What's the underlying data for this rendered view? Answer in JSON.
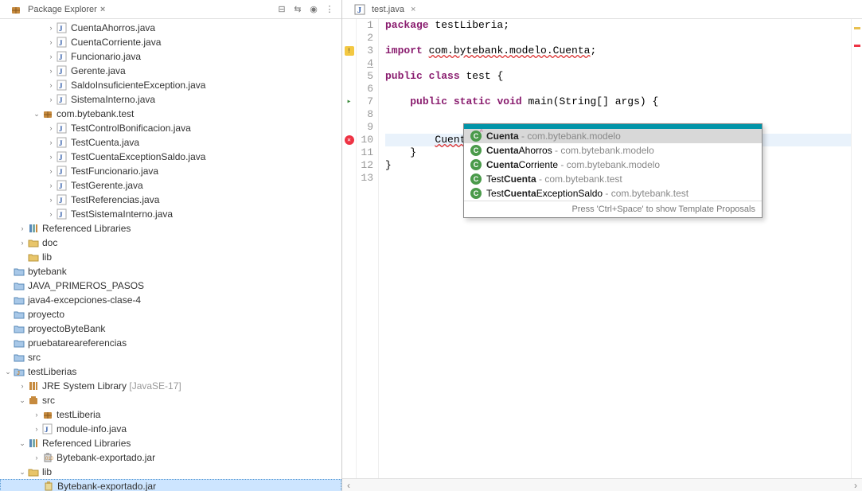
{
  "explorer": {
    "title": "Package Explorer",
    "tree": [
      {
        "indent": 3,
        "twisty": ">",
        "icon": "java",
        "label": "CuentaAhorros.java"
      },
      {
        "indent": 3,
        "twisty": ">",
        "icon": "java",
        "label": "CuentaCorriente.java"
      },
      {
        "indent": 3,
        "twisty": ">",
        "icon": "java",
        "label": "Funcionario.java"
      },
      {
        "indent": 3,
        "twisty": ">",
        "icon": "java",
        "label": "Gerente.java"
      },
      {
        "indent": 3,
        "twisty": ">",
        "icon": "java",
        "label": "SaldoInsuficienteException.java"
      },
      {
        "indent": 3,
        "twisty": ">",
        "icon": "java",
        "label": "SistemaInterno.java"
      },
      {
        "indent": 2,
        "twisty": "v",
        "icon": "pkg",
        "label": "com.bytebank.test"
      },
      {
        "indent": 3,
        "twisty": ">",
        "icon": "java",
        "label": "TestControlBonificacion.java"
      },
      {
        "indent": 3,
        "twisty": ">",
        "icon": "java",
        "label": "TestCuenta.java"
      },
      {
        "indent": 3,
        "twisty": ">",
        "icon": "java",
        "label": "TestCuentaExceptionSaldo.java"
      },
      {
        "indent": 3,
        "twisty": ">",
        "icon": "java",
        "label": "TestFuncionario.java"
      },
      {
        "indent": 3,
        "twisty": ">",
        "icon": "java",
        "label": "TestGerente.java"
      },
      {
        "indent": 3,
        "twisty": ">",
        "icon": "java",
        "label": "TestReferencias.java"
      },
      {
        "indent": 3,
        "twisty": ">",
        "icon": "java",
        "label": "TestSistemaInterno.java"
      },
      {
        "indent": 1,
        "twisty": ">",
        "icon": "lib",
        "label": "Referenced Libraries"
      },
      {
        "indent": 1,
        "twisty": ">",
        "icon": "folder",
        "label": "doc"
      },
      {
        "indent": 1,
        "twisty": " ",
        "icon": "folder",
        "label": "lib"
      },
      {
        "indent": 0,
        "twisty": " ",
        "icon": "proj",
        "label": "bytebank"
      },
      {
        "indent": 0,
        "twisty": " ",
        "icon": "proj",
        "label": "JAVA_PRIMEROS_PASOS"
      },
      {
        "indent": 0,
        "twisty": " ",
        "icon": "proj",
        "label": "java4-excepciones-clase-4"
      },
      {
        "indent": 0,
        "twisty": " ",
        "icon": "proj",
        "label": "proyecto"
      },
      {
        "indent": 0,
        "twisty": " ",
        "icon": "proj",
        "label": "proyectoByteBank"
      },
      {
        "indent": 0,
        "twisty": " ",
        "icon": "proj",
        "label": "pruebatareareferencias"
      },
      {
        "indent": 0,
        "twisty": " ",
        "icon": "proj",
        "label": "src"
      },
      {
        "indent": 0,
        "twisty": "v",
        "icon": "javaproj",
        "label": "testLiberias"
      },
      {
        "indent": 1,
        "twisty": ">",
        "icon": "jre",
        "label": "JRE System Library",
        "dim": "[JavaSE-17]"
      },
      {
        "indent": 1,
        "twisty": "v",
        "icon": "src",
        "label": "src"
      },
      {
        "indent": 2,
        "twisty": ">",
        "icon": "pkg",
        "label": "testLiberia"
      },
      {
        "indent": 2,
        "twisty": ">",
        "icon": "java",
        "label": "module-info.java"
      },
      {
        "indent": 1,
        "twisty": "v",
        "icon": "lib",
        "label": "Referenced Libraries"
      },
      {
        "indent": 2,
        "twisty": ">",
        "icon": "jar",
        "label": "Bytebank-exportado.jar"
      },
      {
        "indent": 1,
        "twisty": "v",
        "icon": "folder",
        "label": "lib"
      },
      {
        "indent": 2,
        "twisty": " ",
        "icon": "jarfile",
        "label": "Bytebank-exportado.jar",
        "selected": true
      }
    ]
  },
  "editor": {
    "tab_title": "test.java",
    "lines": [
      {
        "n": 1,
        "html": "<span class='kw'>package</span> testLiberia;"
      },
      {
        "n": 2,
        "html": ""
      },
      {
        "n": 3,
        "html": "<span class='kw'>import</span> <span class='err-underline'>com.bytebank.modelo.Cuenta</span>;",
        "mark": "warn"
      },
      {
        "n": 4,
        "html": "",
        "underline": true
      },
      {
        "n": 5,
        "html": "<span class='kw'>public</span> <span class='kw'>class</span> test {"
      },
      {
        "n": 6,
        "html": ""
      },
      {
        "n": 7,
        "html": "    <span class='kw'>public</span> <span class='kw'>static</span> <span class='kw'>void</span> main(String[] args) {",
        "mark": "run",
        "fold": true
      },
      {
        "n": 8,
        "html": ""
      },
      {
        "n": 9,
        "html": ""
      },
      {
        "n": 10,
        "html": "        <span class='err-underline'>Cuenta</span><span class='cursor'></span>",
        "mark": "error",
        "hl": true
      },
      {
        "n": 11,
        "html": "    }"
      },
      {
        "n": 12,
        "html": "}"
      },
      {
        "n": 13,
        "html": ""
      }
    ]
  },
  "content_assist": {
    "items": [
      {
        "name": "Cuenta",
        "pkg": "com.bytebank.modelo",
        "abstract": true,
        "sel": true
      },
      {
        "name": "CuentaAhorros",
        "pkg": "com.bytebank.modelo"
      },
      {
        "name": "CuentaCorriente",
        "pkg": "com.bytebank.modelo"
      },
      {
        "name": "TestCuenta",
        "pkg": "com.bytebank.test"
      },
      {
        "name": "TestCuentaExceptionSaldo",
        "pkg": "com.bytebank.test"
      }
    ],
    "filter": "Cuenta",
    "footer": "Press 'Ctrl+Space' to show Template Proposals"
  }
}
